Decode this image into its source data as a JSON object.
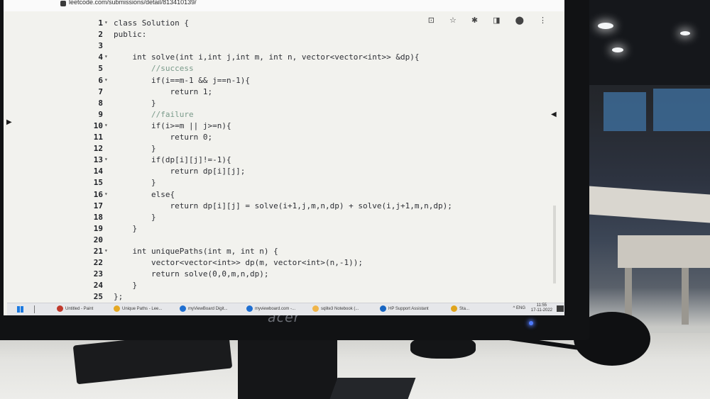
{
  "browser": {
    "url": "leetcode.com/submissions/detail/813410139/",
    "toolbar_icons": "⊡ ☆ ✱ ◨ ⬤ ⋮"
  },
  "editor": {
    "lines": [
      {
        "n": "1",
        "fold": "▾",
        "code": "class Solution {"
      },
      {
        "n": "2",
        "fold": "",
        "code": "public:"
      },
      {
        "n": "3",
        "fold": "",
        "code": ""
      },
      {
        "n": "4",
        "fold": "▾",
        "code": "    int solve(int i,int j,int m, int n, vector<vector<int>> &dp){"
      },
      {
        "n": "5",
        "fold": "",
        "code": "        //success"
      },
      {
        "n": "6",
        "fold": "▾",
        "code": "        if(i==m-1 && j==n-1){"
      },
      {
        "n": "7",
        "fold": "",
        "code": "            return 1;"
      },
      {
        "n": "8",
        "fold": "",
        "code": "        }"
      },
      {
        "n": "9",
        "fold": "",
        "code": "        //failure"
      },
      {
        "n": "10",
        "fold": "▾",
        "code": "        if(i>=m || j>=n){"
      },
      {
        "n": "11",
        "fold": "",
        "code": "            return 0;"
      },
      {
        "n": "12",
        "fold": "",
        "code": "        }"
      },
      {
        "n": "13",
        "fold": "▾",
        "code": "        if(dp[i][j]!=-1){"
      },
      {
        "n": "14",
        "fold": "",
        "code": "            return dp[i][j];"
      },
      {
        "n": "15",
        "fold": "",
        "code": "        }"
      },
      {
        "n": "16",
        "fold": "▾",
        "code": "        else{"
      },
      {
        "n": "17",
        "fold": "",
        "code": "            return dp[i][j] = solve(i+1,j,m,n,dp) + solve(i,j+1,m,n,dp);"
      },
      {
        "n": "18",
        "fold": "",
        "code": "        }"
      },
      {
        "n": "19",
        "fold": "",
        "code": "    }"
      },
      {
        "n": "20",
        "fold": "",
        "code": ""
      },
      {
        "n": "21",
        "fold": "▾",
        "code": "    int uniquePaths(int m, int n) {"
      },
      {
        "n": "22",
        "fold": "",
        "code": "        vector<vector<int>> dp(m, vector<int>(n,-1));"
      },
      {
        "n": "23",
        "fold": "",
        "code": "        return solve(0,0,m,n,dp);"
      },
      {
        "n": "24",
        "fold": "",
        "code": "    }"
      },
      {
        "n": "25",
        "fold": "",
        "code": "};"
      }
    ]
  },
  "taskbar": {
    "items": [
      {
        "label": "Untitled - Paint",
        "color": "#c0392b"
      },
      {
        "label": "Unique Paths - Lee...",
        "color": "#e5a823"
      },
      {
        "label": "myViewBoard Digit...",
        "color": "#1f6fd1"
      },
      {
        "label": "myviewboard.com -...",
        "color": "#1f6fd1"
      },
      {
        "label": "sqlite3 Notebook (...",
        "color": "#f0b54a"
      },
      {
        "label": "HP Support Assistant",
        "color": "#1765c2"
      },
      {
        "label": "Sta...",
        "color": "#e0a41c"
      }
    ],
    "tray": "^ ENG",
    "time": "11:55",
    "date": "17-11-2022"
  },
  "monitor": {
    "brand": "acer"
  }
}
